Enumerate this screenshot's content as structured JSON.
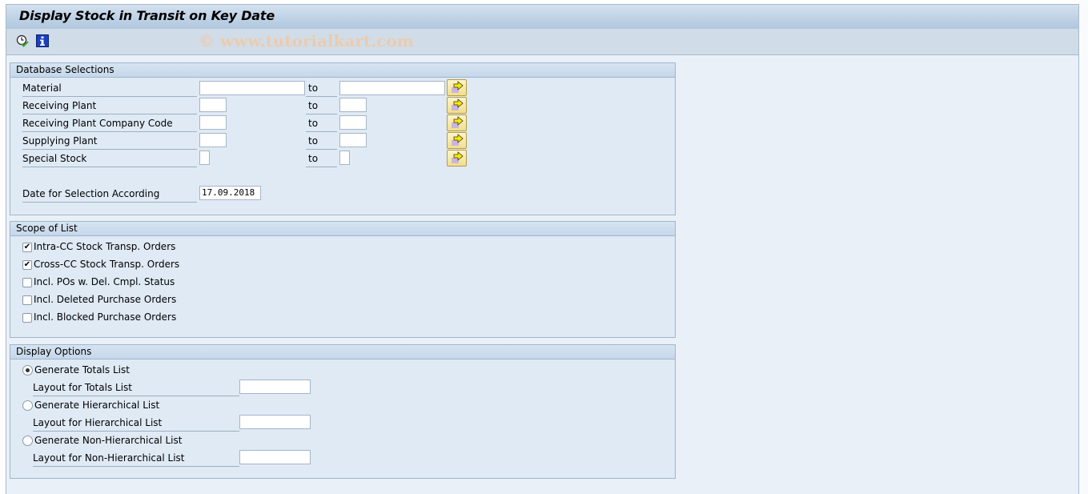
{
  "window": {
    "title": "Display Stock in Transit on Key Date"
  },
  "toolbar": {
    "execute_icon": "execute-clock-check-icon",
    "info_icon": "info-icon",
    "watermark": "© www.tutorialkart.com"
  },
  "database_selections": {
    "title": "Database Selections",
    "rows": [
      {
        "label": "Material",
        "from": "",
        "to_label": "to",
        "to": ""
      },
      {
        "label": "Receiving Plant",
        "from": "",
        "to_label": "to",
        "to": ""
      },
      {
        "label": "Receiving Plant Company Code",
        "from": "",
        "to_label": "to",
        "to": ""
      },
      {
        "label": "Supplying Plant",
        "from": "",
        "to_label": "to",
        "to": ""
      },
      {
        "label": "Special Stock",
        "from": "",
        "to_label": "to",
        "to": ""
      }
    ],
    "date_label": "Date for Selection According",
    "date_value": "17.09.2018"
  },
  "scope_of_list": {
    "title": "Scope of List",
    "options": [
      {
        "label": "Intra-CC Stock Transp. Orders",
        "checked": true
      },
      {
        "label": "Cross-CC Stock Transp. Orders",
        "checked": true
      },
      {
        "label": "Incl. POs w. Del. Cmpl. Status",
        "checked": false
      },
      {
        "label": "Incl. Deleted Purchase Orders",
        "checked": false
      },
      {
        "label": "Incl. Blocked Purchase Orders",
        "checked": false
      }
    ]
  },
  "display_options": {
    "title": "Display Options",
    "options": [
      {
        "label": "Generate Totals List",
        "selected": true,
        "layout_label": "Layout for Totals List",
        "layout_value": ""
      },
      {
        "label": "Generate Hierarchical List",
        "selected": false,
        "layout_label": "Layout for Hierarchical List",
        "layout_value": ""
      },
      {
        "label": "Generate Non-Hierarchical List",
        "selected": false,
        "layout_label": "Layout for Non-Hierarchical List",
        "layout_value": ""
      }
    ]
  },
  "colors": {
    "accent_button": "#f2de8c",
    "watermark": "#f2c9a4"
  }
}
